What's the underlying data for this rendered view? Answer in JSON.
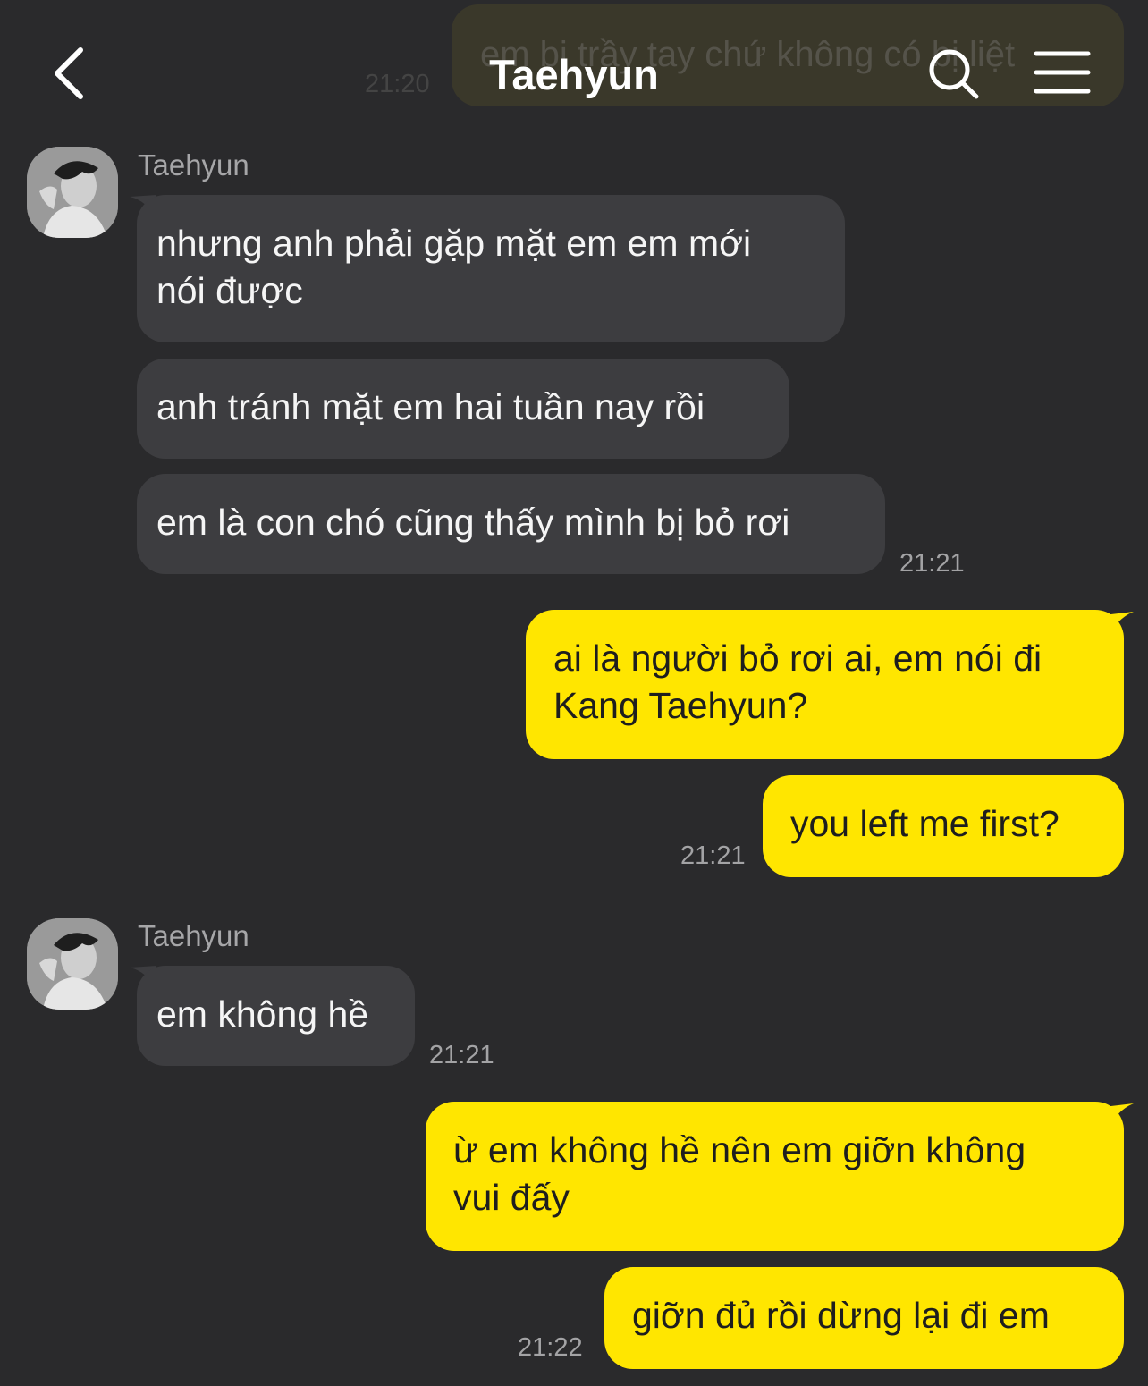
{
  "header": {
    "title": "Taehyun",
    "back_icon": "chevron-left-icon",
    "search_icon": "search-icon",
    "menu_icon": "hamburger-menu-icon"
  },
  "partial_previous": {
    "text": "em bị trầy tay chứ không có bị liệt",
    "time": "21:20"
  },
  "colors": {
    "background": "#2a2a2c",
    "incoming_bubble": "#3d3d40",
    "outgoing_bubble": "#ffe600",
    "timestamp": "#a3a3a5"
  },
  "groups": [
    {
      "sender": "Taehyun",
      "messages": [
        "nhưng anh phải gặp mặt em em mới\nnói được",
        "anh tránh mặt em hai tuần nay rồi",
        "em là con chó cũng thấy mình bị bỏ rơi"
      ],
      "time": "21:21"
    },
    {
      "sender": "me",
      "messages": [
        "ai là người bỏ rơi ai, em nói đi\nKang Taehyun?",
        "you left me first?"
      ],
      "time": "21:21"
    },
    {
      "sender": "Taehyun",
      "messages": [
        "em không hề"
      ],
      "time": "21:21"
    },
    {
      "sender": "me",
      "messages": [
        "ừ em không hề nên em giỡn không\nvui đấy",
        "giỡn đủ rồi dừng lại đi em"
      ],
      "time": "21:22"
    }
  ]
}
